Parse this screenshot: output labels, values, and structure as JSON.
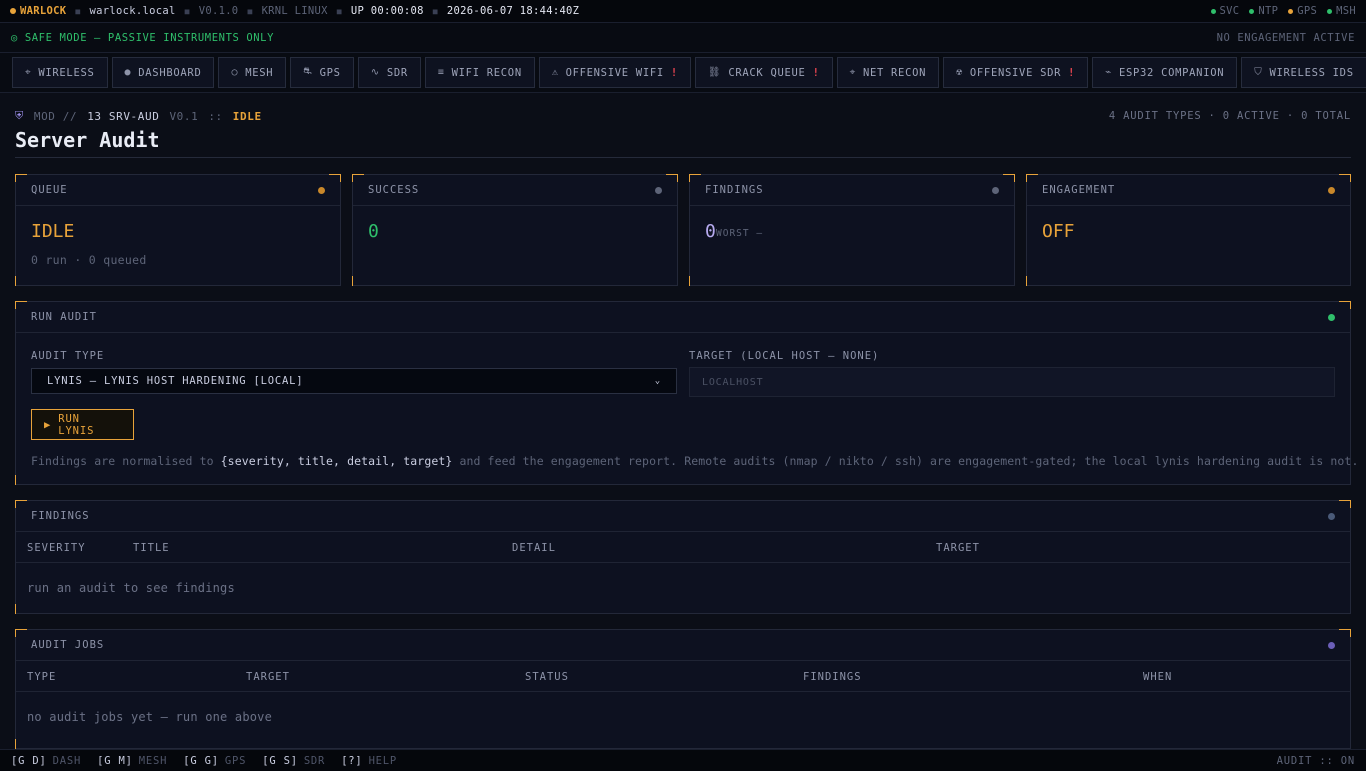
{
  "topbar": {
    "brand": "WARLOCK",
    "host": "warlock.local",
    "version": "V0.1.0",
    "kernel": "KRNL LINUX",
    "uptime": "UP 00:00:08",
    "clock": "2026-06-07 18:44:40Z",
    "indicators": [
      {
        "label": "SVC",
        "color": "#2fbf6b"
      },
      {
        "label": "NTP",
        "color": "#2fbf6b"
      },
      {
        "label": "GPS",
        "color": "#e8a33a"
      },
      {
        "label": "MSH",
        "color": "#2fbf6b"
      }
    ]
  },
  "safebar": {
    "mode": "◎ SAFE MODE — PASSIVE INSTRUMENTS ONLY",
    "engagement": "NO ENGAGEMENT ACTIVE"
  },
  "tabs": [
    {
      "icon": "⌖",
      "label": "WIRELESS",
      "warn": ""
    },
    {
      "icon": "●",
      "label": "DASHBOARD",
      "warn": ""
    },
    {
      "icon": "○",
      "label": "MESH",
      "warn": ""
    },
    {
      "icon": "⛐",
      "label": "GPS",
      "warn": ""
    },
    {
      "icon": "∿",
      "label": "SDR",
      "warn": ""
    },
    {
      "icon": "≡",
      "label": "WIFI RECON",
      "warn": ""
    },
    {
      "icon": "⚠",
      "label": "OFFENSIVE WIFI",
      "warn": "!"
    },
    {
      "icon": "⛓",
      "label": "CRACK QUEUE",
      "warn": "!"
    },
    {
      "icon": "⌖",
      "label": "NET RECON",
      "warn": ""
    },
    {
      "icon": "☢",
      "label": "OFFENSIVE SDR",
      "warn": "!"
    },
    {
      "icon": "⌁",
      "label": "ESP32 COMPANION",
      "warn": ""
    },
    {
      "icon": "⛉",
      "label": "WIRELESS IDS",
      "warn": ""
    }
  ],
  "module": {
    "prefix": "MOD //",
    "id": "13 SRV-AUD",
    "version": "V0.1",
    "separator": "::",
    "state": "IDLE",
    "counts": "4 AUDIT TYPES · 0 ACTIVE · 0 TOTAL",
    "title": "Server Audit"
  },
  "stats": [
    {
      "label": "QUEUE",
      "value": "IDLE",
      "sub": "0 run · 0 queued",
      "value_color": "#e8a33a",
      "led": "#c9882a"
    },
    {
      "label": "SUCCESS",
      "value": "0",
      "sub": "",
      "value_color": "#2fbf6b",
      "led": "#5d6478"
    },
    {
      "label": "FINDINGS",
      "value": "0",
      "sub": "WORST —",
      "value_color": "#b7abf0",
      "led": "#5d6478"
    },
    {
      "label": "ENGAGEMENT",
      "value": "OFF",
      "sub": "",
      "value_color": "#e8a33a",
      "led": "#c9882a"
    }
  ],
  "run_audit": {
    "title": "RUN AUDIT",
    "led": "#2fbf6b",
    "type_label": "AUDIT TYPE",
    "type_value": "LYNIS — LYNIS HOST HARDENING [LOCAL]",
    "target_label": "TARGET (LOCAL HOST — NONE)",
    "target_placeholder": "LOCALHOST",
    "button": "RUN LYNIS",
    "note_pre": "Findings are normalised to ",
    "note_code": "{severity, title, detail, target}",
    "note_post": " and feed the engagement report. Remote audits (nmap / nikto / ssh) are engagement-gated; the local lynis hardening audit is not."
  },
  "findings": {
    "title": "FINDINGS",
    "led": "#4a5a78",
    "columns": [
      "SEVERITY",
      "TITLE",
      "DETAIL",
      "TARGET"
    ],
    "empty": "run an audit to see findings"
  },
  "jobs": {
    "title": "AUDIT JOBS",
    "led": "#6b5fb8",
    "columns": [
      "TYPE",
      "TARGET",
      "STATUS",
      "FINDINGS",
      "WHEN"
    ],
    "empty": "no audit jobs yet — run one above"
  },
  "footer": {
    "shortcuts": [
      {
        "key": "[G D]",
        "action": "DASH"
      },
      {
        "key": "[G M]",
        "action": "MESH"
      },
      {
        "key": "[G G]",
        "action": "GPS"
      },
      {
        "key": "[G S]",
        "action": "SDR"
      },
      {
        "key": "[?]",
        "action": "HELP"
      }
    ],
    "status": "AUDIT :: ON"
  }
}
